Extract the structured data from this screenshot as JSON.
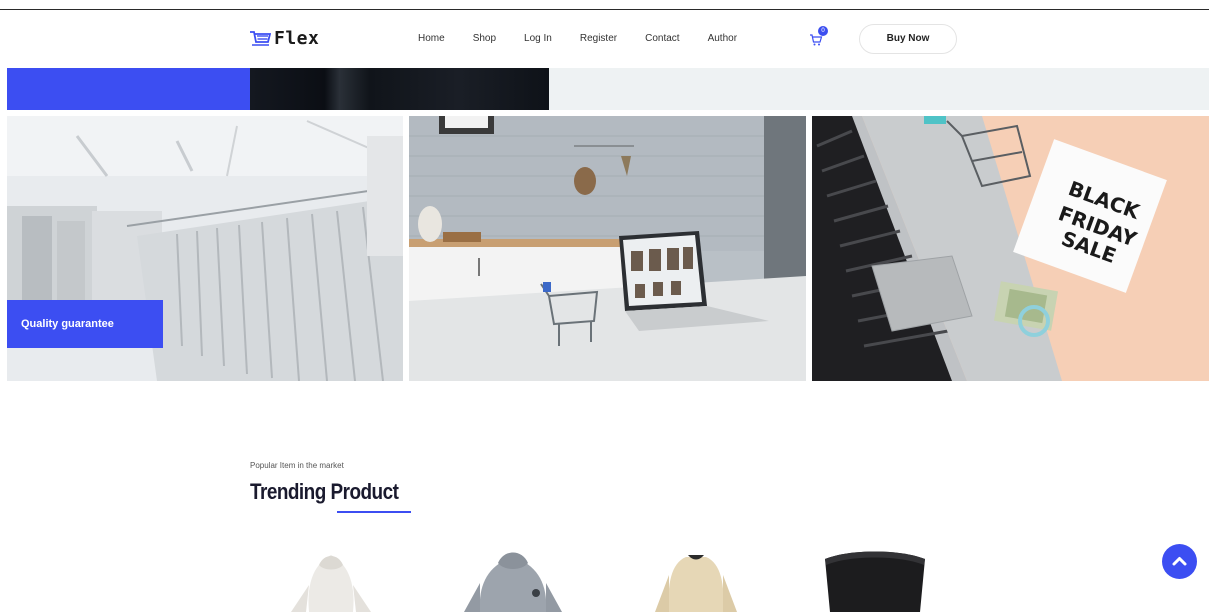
{
  "header": {
    "brand": "Flex",
    "nav": [
      "Home",
      "Shop",
      "Log In",
      "Register",
      "Contact",
      "Author"
    ],
    "cart_count": "0",
    "buy_now_label": "Buy Now"
  },
  "banners": {
    "quality_label": "Quality guarantee",
    "black_friday_lines": [
      "BLACK",
      "FRIDAY",
      "SALE"
    ]
  },
  "trending": {
    "subtitle": "Popular Item in the market",
    "title": "Trending Product"
  },
  "colors": {
    "accent": "#3c4ef2",
    "text_dark": "#1a1a2e"
  },
  "icons": [
    "cart-logo-icon",
    "shopping-cart-icon",
    "chevron-up-icon"
  ]
}
